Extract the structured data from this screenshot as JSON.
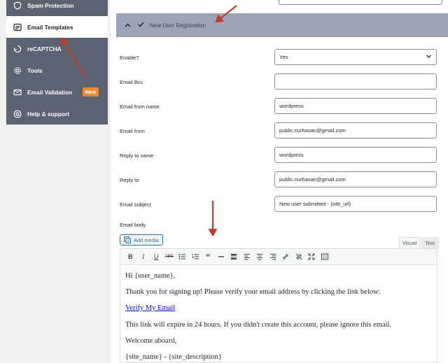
{
  "sidebar": {
    "items": [
      {
        "label": "Spam Protection",
        "icon": "shield-icon",
        "active": false
      },
      {
        "label": "Email Templates",
        "icon": "email-template-icon",
        "active": true
      },
      {
        "label": "reCAPTCHA",
        "icon": "recaptcha-icon",
        "active": false
      },
      {
        "label": "Tools",
        "icon": "gear-icon",
        "active": false
      },
      {
        "label": "Email Validation",
        "icon": "email-check-icon",
        "active": false,
        "badge": "New"
      },
      {
        "label": "Help & support",
        "icon": "help-icon",
        "active": false
      }
    ]
  },
  "accordion": {
    "title": "New User Registration",
    "expanded": true,
    "enabled": true
  },
  "form": {
    "enable": {
      "label": "Enable?",
      "value": "Yes"
    },
    "email_bcc": {
      "label": "Email Bcc",
      "value": ""
    },
    "email_from_name": {
      "label": "Email from name",
      "value": "wordpress"
    },
    "email_from": {
      "label": "Email from",
      "value": "public.nurhasan@gmail.com"
    },
    "reply_to_name": {
      "label": "Reply to name",
      "value": "wordpress"
    },
    "reply_to": {
      "label": "Reply to",
      "value": "public.nurhasan@gmail.com"
    },
    "email_subject": {
      "label": "Email subject",
      "value": "New user submitted - {site_url}"
    },
    "email_body": {
      "label": "Email body"
    }
  },
  "editor": {
    "add_media_label": "Add media",
    "tab_visual": "Visual",
    "tab_text": "Text",
    "active_tab": "Visual",
    "toolbar": [
      "bold",
      "italic",
      "underline",
      "strikethrough",
      "bullet-list",
      "numbered-list",
      "blockquote",
      "horizontal-rule",
      "read-more",
      "align-left",
      "align-center",
      "align-right",
      "insert-link",
      "remove-link",
      "fullscreen",
      "toolbar-toggle"
    ],
    "body": {
      "greeting": "Hi {user_name},",
      "line1": "Thank you for signing up! Please verify your email address by clicking the link below:",
      "verify_link": "Verify My Email",
      "line2": "This link will expire in 24 hours. If you didn't create this account, please ignore this email.",
      "line3": "Welcome aboard,",
      "signature": "{site_name} - {site_description}"
    }
  },
  "colors": {
    "sidebar_bg": "#5b6271",
    "accordion_bg": "#9ca3b4",
    "badge": "#f08b2e",
    "arrow": "#c0392b",
    "link": "#2271b1"
  }
}
